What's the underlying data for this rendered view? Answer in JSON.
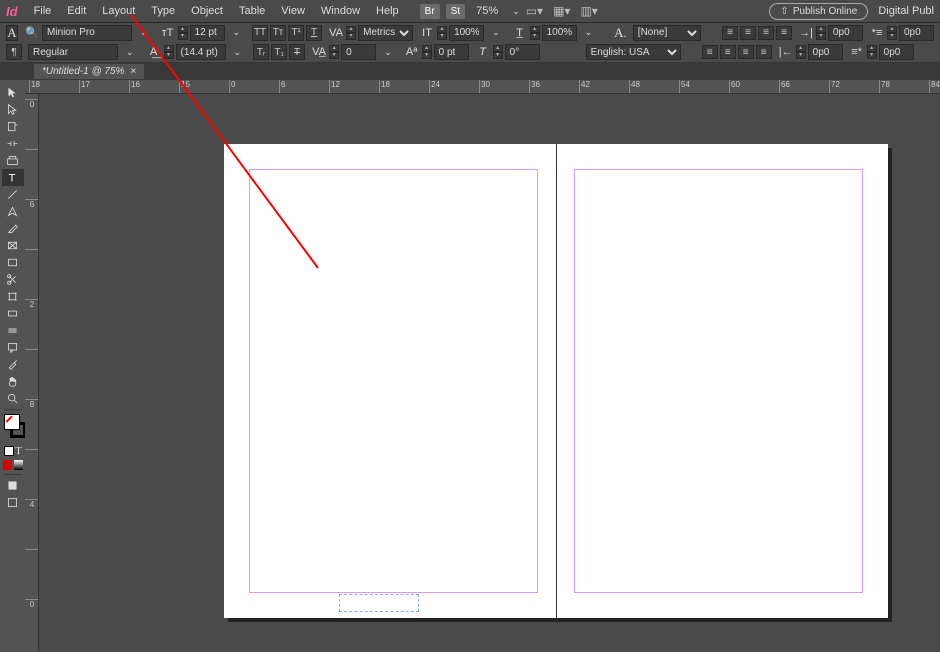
{
  "app_icon": "Id",
  "menu": [
    "File",
    "Edit",
    "Layout",
    "Type",
    "Object",
    "Table",
    "View",
    "Window",
    "Help"
  ],
  "menu_badges": [
    "Br",
    "St"
  ],
  "zoom": "75%",
  "publish_label": "Publish Online",
  "workspace_name": "Digital Publ",
  "doc_tab": "*Untitled-1 @ 75%",
  "font": {
    "family": "Minion Pro",
    "style": "Regular",
    "size": "12 pt",
    "leading": "(14.4 pt)"
  },
  "kerning": "Metrics",
  "tracking": "0",
  "vscale": "100%",
  "hscale": "100%",
  "baseline": "0 pt",
  "skew": "0°",
  "char_style": "[None]",
  "language": "English: USA",
  "indents": {
    "left": "0p0",
    "right": "0p0",
    "first": "0p0",
    "last": "0p0"
  },
  "ruler_h": [
    {
      "p": -10,
      "l": "18"
    },
    {
      "p": 40,
      "l": "17"
    },
    {
      "p": 90,
      "l": "16"
    },
    {
      "p": 140,
      "l": "15"
    },
    {
      "p": 190,
      "l": "0"
    },
    {
      "p": 240,
      "l": "6"
    },
    {
      "p": 290,
      "l": "12"
    },
    {
      "p": 340,
      "l": "18"
    },
    {
      "p": 390,
      "l": "24"
    },
    {
      "p": 440,
      "l": "30"
    },
    {
      "p": 490,
      "l": "36"
    },
    {
      "p": 540,
      "l": "42"
    },
    {
      "p": 590,
      "l": "48"
    },
    {
      "p": 640,
      "l": "54"
    },
    {
      "p": 690,
      "l": "60"
    },
    {
      "p": 740,
      "l": "66"
    },
    {
      "p": 790,
      "l": "72"
    },
    {
      "p": 840,
      "l": "78"
    },
    {
      "p": 890,
      "l": "84"
    }
  ],
  "ruler_v": [
    {
      "p": 5,
      "l": "0"
    },
    {
      "p": 55,
      "l": ""
    },
    {
      "p": 105,
      "l": "6"
    },
    {
      "p": 155,
      "l": ""
    },
    {
      "p": 205,
      "l": "2"
    },
    {
      "p": 255,
      "l": ""
    },
    {
      "p": 305,
      "l": "8"
    },
    {
      "p": 355,
      "l": ""
    },
    {
      "p": 405,
      "l": "4"
    },
    {
      "p": 455,
      "l": ""
    },
    {
      "p": 505,
      "l": "0"
    }
  ]
}
